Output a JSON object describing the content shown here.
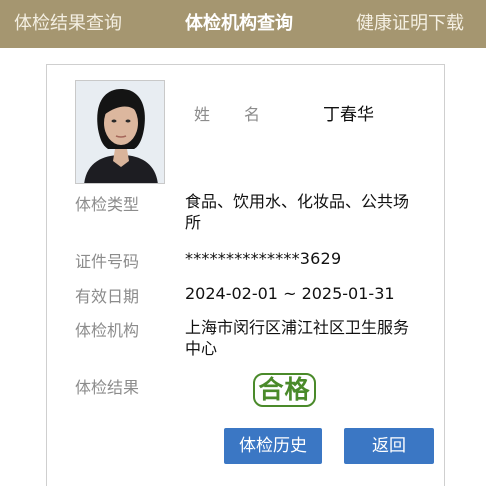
{
  "nav": {
    "tabs": [
      {
        "label": "体检结果查询",
        "active": false
      },
      {
        "label": "体检机构查询",
        "active": true
      },
      {
        "label": "健康证明下载",
        "active": false
      }
    ],
    "bar_color": "#a59670"
  },
  "profile": {
    "name_label": "姓名",
    "name": "丁春华"
  },
  "details": {
    "type_label": "体检类型",
    "type_value": "食品、饮用水、化妆品、公共场所",
    "id_label": "证件号码",
    "id_value": "**************3629",
    "validity_label": "有效日期",
    "validity_value": "2024-02-01 ~ 2025-01-31",
    "org_label": "体检机构",
    "org_value": "上海市闵行区浦江社区卫生服务中心",
    "result_label": "体检结果",
    "result_value": "合格",
    "result_color": "#4a8a2a"
  },
  "actions": {
    "history_label": "体检历史",
    "back_label": "返回",
    "button_color": "#3b77c4"
  }
}
